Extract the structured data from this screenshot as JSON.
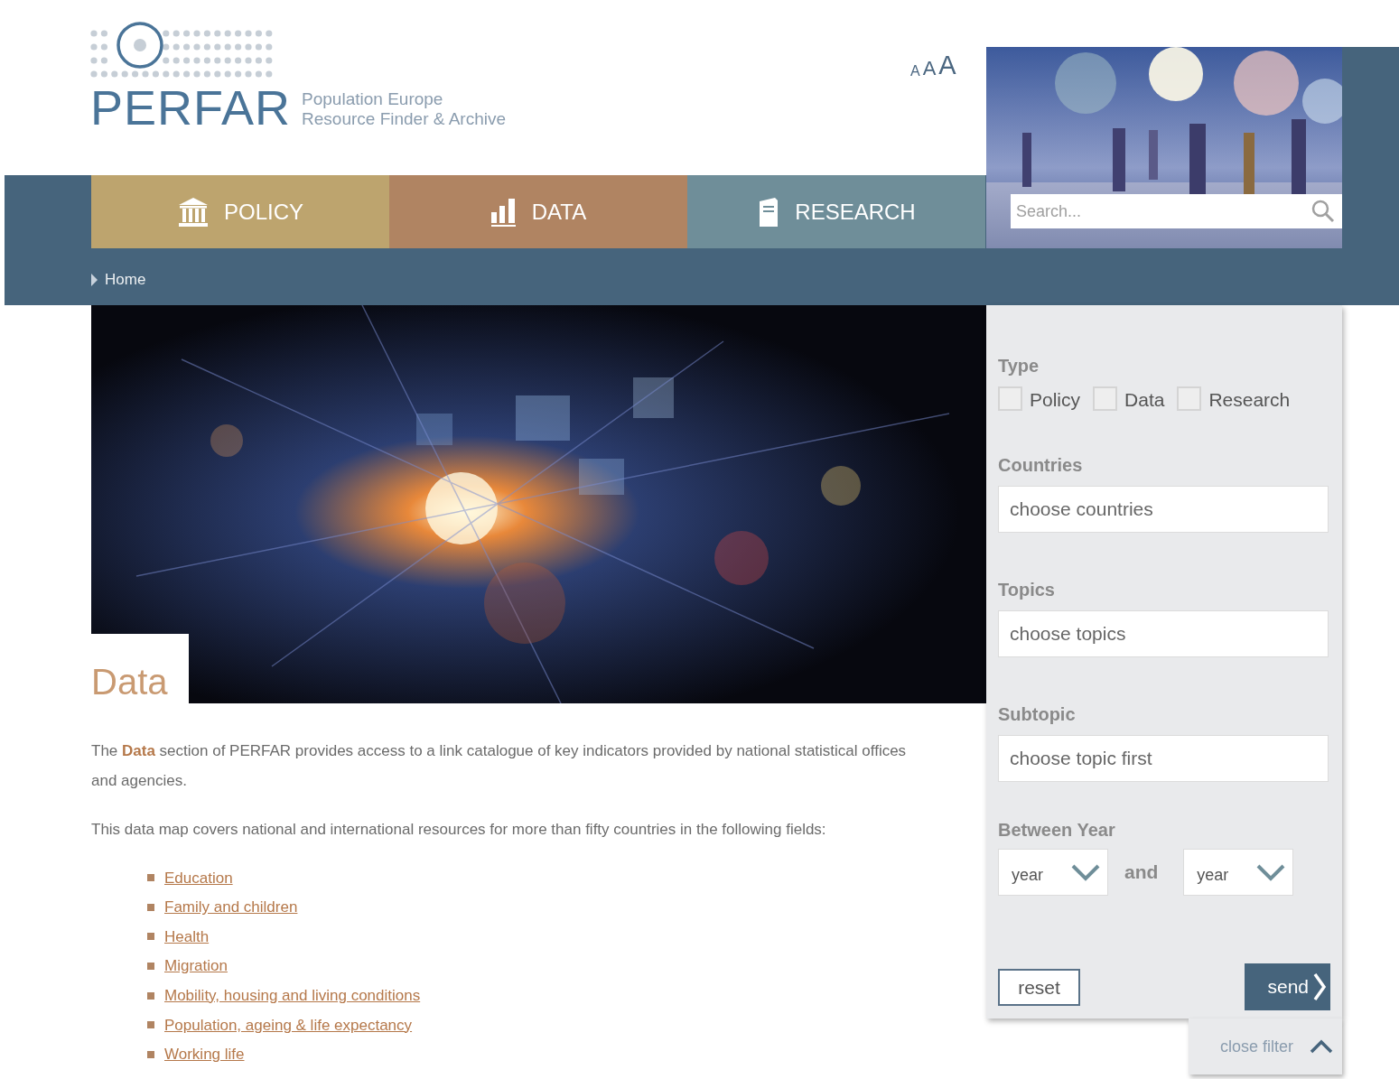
{
  "logo": {
    "name": "PERFAR",
    "tagline": [
      "Population Europe",
      "Resource Finder & Archive"
    ]
  },
  "text_size": [
    "A",
    "A",
    "A"
  ],
  "nav_tabs": [
    {
      "label": "POLICY",
      "kind": "policy",
      "color": "#bda46e"
    },
    {
      "label": "DATA",
      "kind": "data",
      "color": "#b08462"
    },
    {
      "label": "RESEARCH",
      "kind": "research",
      "color": "#6f8e99"
    }
  ],
  "search": {
    "placeholder": "Search..."
  },
  "breadcrumb": [
    "Home"
  ],
  "page_title": "Data",
  "intro": "The **Data** section of PERFAR provides access to a link catalogue of key indicators provided by national statistical offices and agencies.",
  "lead": "This data map covers national and international resources for more than fifty countries in the following fields:",
  "fields": [
    "Education",
    "Family and children",
    "Health",
    "Migration",
    "Mobility, housing and living conditions",
    "Population, ageing & life expectancy",
    "Working life"
  ],
  "filter": {
    "type_label": "Type",
    "types": [
      {
        "label": "Policy",
        "checked": false
      },
      {
        "label": "Data",
        "checked": false
      },
      {
        "label": "Research",
        "checked": false
      }
    ],
    "countries": {
      "label": "Countries",
      "placeholder": "choose countries"
    },
    "topics": {
      "label": "Topics",
      "placeholder": "choose topics"
    },
    "subtopic": {
      "label": "Subtopic",
      "placeholder": "choose topic first"
    },
    "years": {
      "label": "Between Year",
      "from": "year",
      "joiner": "and",
      "to": "year"
    },
    "reset": "reset",
    "send": "send",
    "close": "close filter"
  }
}
